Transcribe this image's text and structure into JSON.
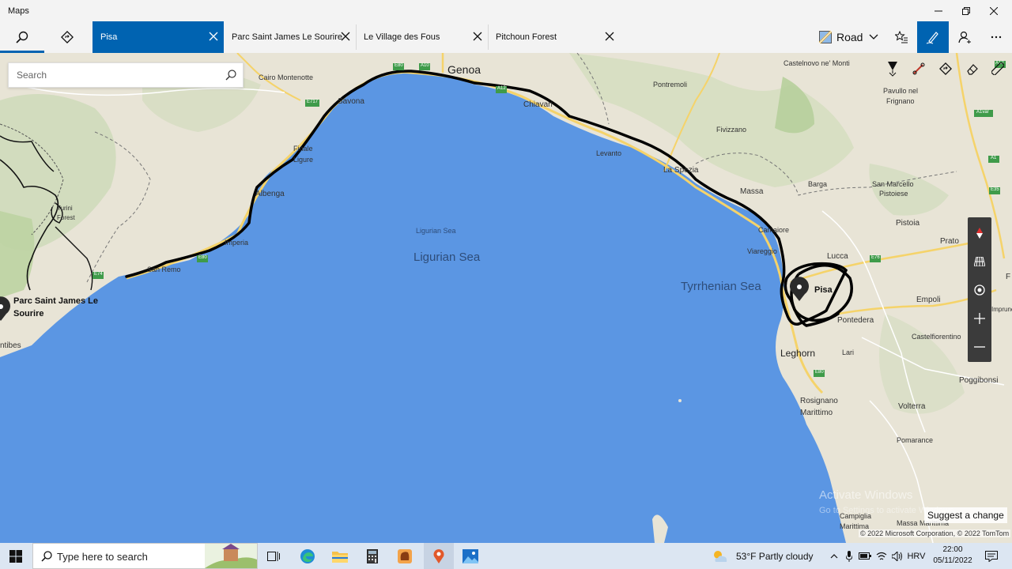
{
  "window": {
    "title": "Maps"
  },
  "toolbar": {
    "tabs": [
      {
        "label": "Pisa",
        "active": true
      },
      {
        "label": "Parc Saint James Le Sourire",
        "active": false
      },
      {
        "label": "Le Village des Fous",
        "active": false
      },
      {
        "label": "Pitchoun Forest",
        "active": false
      }
    ],
    "map_style": "Road"
  },
  "search": {
    "placeholder": "Search"
  },
  "map": {
    "labels": {
      "genoa": "Genoa",
      "savona": "Savona",
      "chiavari": "Chiavari",
      "cairo": "Cairo Montenotte",
      "finale": "Finale\nLigure",
      "finale1": "Finale",
      "finale2": "Ligure",
      "albenga": "Albenga",
      "imperia": "Imperia",
      "sanremo": "San Remo",
      "turini": "Turini\nForest",
      "turini1": "Turini",
      "turini2": "Forest",
      "antibes": "ntibes",
      "levanto": "Levanto",
      "laspezia": "La Spezia",
      "massa": "Massa",
      "camaiore": "Camaiore",
      "viareggio": "Viareggio",
      "lucca": "Lucca",
      "pisa": "Pisa",
      "pontedera": "Pontedera",
      "empoli": "Empoli",
      "leghorn": "Leghorn",
      "lari": "Lari",
      "rosignano1": "Rosignano",
      "rosignano2": "Marittimo",
      "volterra": "Volterra",
      "pomarance": "Pomarance",
      "castelfiorentino": "Castelfiorentino",
      "poggibonsi": "Poggibonsi",
      "prato": "Prato",
      "pistoia": "Pistoia",
      "sanmarcello1": "San Marcello",
      "sanmarcello2": "Pistoiese",
      "barga": "Barga",
      "fivizzano": "Fivizzano",
      "pontremoli": "Pontremoli",
      "castelnovo": "Castelnovo ne' Monti",
      "pavullo1": "Pavullo nel",
      "pavullo2": "Frignano",
      "campiglia1": "Campiglia",
      "campiglia2": "Marittima",
      "massamarittima": "Massa Marittima",
      "ligurian_small": "Ligurian Sea",
      "ligurian_big": "Ligurian Sea",
      "tyrrhenian": "Tyrrhenian Sea",
      "parc1": "Parc Saint James Le",
      "parc2": "Sourire",
      "impruneta": "Impruneta",
      "f_edge": "F"
    },
    "road_shields": [
      "E717",
      "E80",
      "A10",
      "A12",
      "E74",
      "E80",
      "E76",
      "E35",
      "A1",
      "A1var",
      "E80",
      "A12"
    ],
    "suggest_change": "Suggest a change",
    "watermark": {
      "line1": "Activate Windows",
      "line2": "Go to Settings to activate Windows."
    },
    "copyright": "© 2022 Microsoft Corporation, © 2022 TomTom"
  },
  "taskbar": {
    "search_placeholder": "Type here to search",
    "weather": "53°F  Partly cloudy",
    "language": "HRV",
    "time": "22:00",
    "date": "05/11/2022"
  },
  "colors": {
    "accent": "#0063b1",
    "sea": "#5b96e3",
    "land": "#e8e4d6",
    "route": "#000000"
  }
}
